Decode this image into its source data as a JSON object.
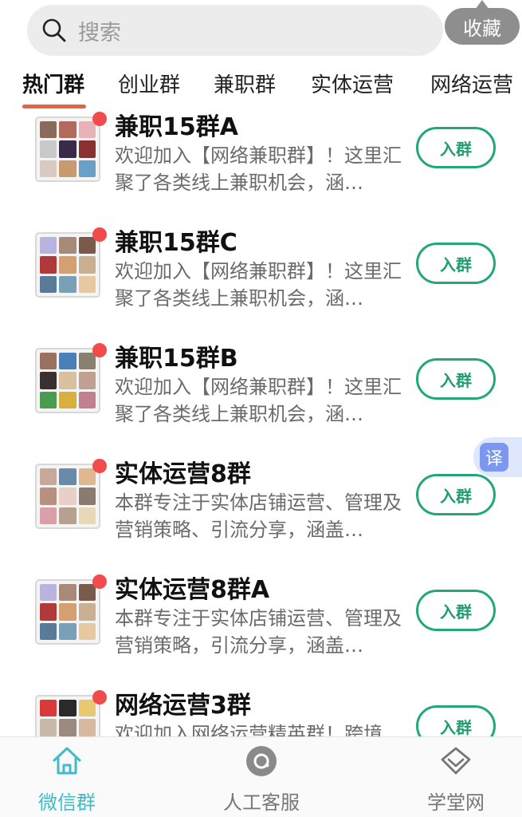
{
  "search": {
    "placeholder": "搜索"
  },
  "favorite": {
    "label": "收藏"
  },
  "tabs": [
    "热门群",
    "创业群",
    "兼职群",
    "实体运营",
    "网络运营"
  ],
  "groups": [
    {
      "name": "兼职15群A",
      "desc": "欢迎加入【网络兼职群】！这里汇聚了各类线上兼职机会，涵…",
      "join": "入群"
    },
    {
      "name": "兼职15群C",
      "desc": "欢迎加入【网络兼职群】！这里汇聚了各类线上兼职机会，涵…",
      "join": "入群"
    },
    {
      "name": "兼职15群B",
      "desc": "欢迎加入【网络兼职群】！这里汇聚了各类线上兼职机会，涵…",
      "join": "入群"
    },
    {
      "name": "实体运营8群",
      "desc": "本群专注于实体店铺运营、管理及营销策略、引流分享，涵盖…",
      "join": "入群"
    },
    {
      "name": "实体运营8群A",
      "desc": "本群专注于实体店铺运营、管理及营销策略，引流分享，涵盖…",
      "join": "入群"
    },
    {
      "name": "网络运营3群",
      "desc": "欢迎加入网络运营精英群！跨境",
      "join": "入群"
    }
  ],
  "translate": {
    "label": "译"
  },
  "bottom_nav": [
    {
      "label": "微信群",
      "icon": "home-icon",
      "active": true
    },
    {
      "label": "人工客服",
      "icon": "customer-service-icon",
      "active": false
    },
    {
      "label": "学堂网",
      "icon": "diamond-icon",
      "active": false
    }
  ],
  "colors": {
    "accent_green": "#21a77a",
    "active_tab_underline": "#e8623d",
    "unread_dot": "#f24b4b",
    "nav_active": "#3fbcc8"
  }
}
